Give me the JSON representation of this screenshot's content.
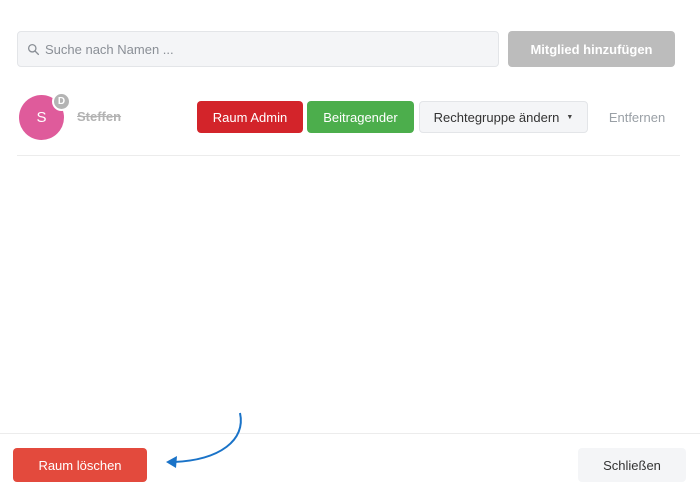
{
  "search": {
    "placeholder": "Suche nach Namen ..."
  },
  "toolbar": {
    "add_member_label": "Mitglied hinzufügen"
  },
  "members": [
    {
      "initial": "S",
      "badge": "D",
      "name": "Steffen",
      "actions": {
        "room_admin": "Raum Admin",
        "contributor": "Beitragender",
        "change_role": "Rechtegruppe ändern",
        "remove": "Entfernen"
      }
    }
  ],
  "footer": {
    "delete_room_label": "Raum löschen",
    "close_label": "Schließen"
  },
  "colors": {
    "avatar": "#df5b9b",
    "room_admin": "#d3242a",
    "contributor": "#4cae4c",
    "delete_room": "#e34a3d",
    "annotation_arrow": "#1a73c8"
  }
}
